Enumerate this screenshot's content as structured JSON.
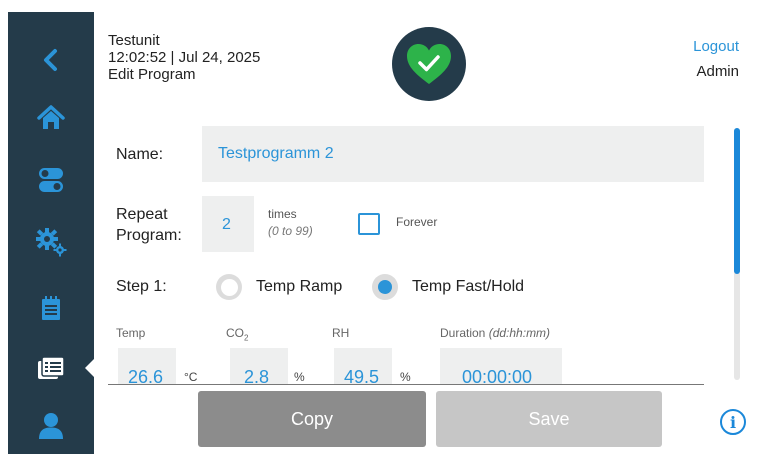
{
  "header": {
    "unit_name": "Testunit",
    "datetime": "12:02:52 | Jul 24, 2025",
    "screen_title": "Edit Program",
    "logout_label": "Logout",
    "user_role": "Admin"
  },
  "status": {
    "icon": "heart-check-icon",
    "color": "#2db34a"
  },
  "sidebar": {
    "items": [
      {
        "name": "back",
        "icon": "chevron-left-icon"
      },
      {
        "name": "home",
        "icon": "home-icon"
      },
      {
        "name": "controls",
        "icon": "toggle-switches-icon"
      },
      {
        "name": "settings",
        "icon": "gears-icon"
      },
      {
        "name": "logbook",
        "icon": "notepad-icon"
      },
      {
        "name": "programs",
        "icon": "program-list-icon",
        "active": true
      },
      {
        "name": "user",
        "icon": "user-icon"
      }
    ]
  },
  "form": {
    "name_label": "Name:",
    "name_value": "Testprogramm 2",
    "repeat_label_line1": "Repeat",
    "repeat_label_line2": "Program:",
    "repeat_value": "2",
    "times_label": "times",
    "times_range": "(0 to 99)",
    "forever_label": "Forever",
    "forever_checked": false,
    "step_label": "Step 1:",
    "mode_options": [
      {
        "label": "Temp Ramp",
        "selected": false
      },
      {
        "label": "Temp Fast/Hold",
        "selected": true
      }
    ],
    "params": {
      "temp_label": "Temp",
      "temp_value": "26.6",
      "temp_unit": "°C",
      "co2_label_main": "CO",
      "co2_label_sub": "2",
      "co2_value": "2.8",
      "co2_unit": "%",
      "rh_label": "RH",
      "rh_value": "49.5",
      "rh_unit": "%",
      "duration_label": "Duration",
      "duration_format": "(dd:hh:mm)",
      "duration_value": "00:00:00"
    }
  },
  "actions": {
    "copy_label": "Copy",
    "save_label": "Save",
    "info_icon": "info-icon"
  },
  "colors": {
    "sidebar_bg": "#243b4a",
    "accent": "#2b94d8",
    "copy_bg": "#8c8c8c",
    "save_bg": "#c6c6c6"
  }
}
